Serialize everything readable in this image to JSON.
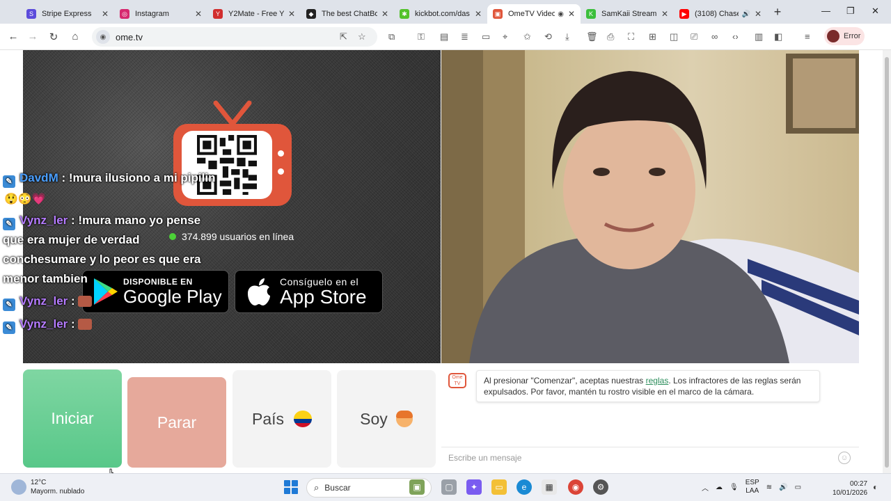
{
  "tabs": [
    {
      "title": "Stripe Express",
      "color": "#5b4bdb",
      "glyph": "S"
    },
    {
      "title": "Instagram",
      "color": "#d6286e",
      "glyph": "◎"
    },
    {
      "title": "Y2Mate - Free Y",
      "color": "#d12e2e",
      "glyph": "Y"
    },
    {
      "title": "The best ChatBo",
      "color": "#222222",
      "glyph": "◆"
    },
    {
      "title": "kickbot.com/das",
      "color": "#53c22b",
      "glyph": "✱"
    },
    {
      "title": "OmeTV Video",
      "color": "#e0563b",
      "glyph": "▣",
      "active": true
    },
    {
      "title": "SamKaii Stream",
      "color": "#3cbf3c",
      "glyph": "K"
    },
    {
      "title": "(3108) Chase",
      "color": "#ff0000",
      "glyph": "▶"
    }
  ],
  "browser": {
    "url": "ome.tv",
    "error_label": "Error"
  },
  "chat_overlay": {
    "lines": [
      {
        "user": "DavdM",
        "text": " : !mura ilusiono a mi pipilin"
      },
      {
        "user": "Vynz_ler",
        "text": " : !mura mano yo pense"
      },
      {
        "text": "que era mujer de verdad"
      },
      {
        "text": "conchesumare y lo peor es que era"
      },
      {
        "text": "menor tambien"
      },
      {
        "user": "Vynz_ler",
        "text": " : "
      },
      {
        "user": "Vynz_ler",
        "text": " : "
      }
    ],
    "emoji_row": "😲😳💗"
  },
  "online": {
    "count_text": "374.899 usuarios en línea"
  },
  "stores": {
    "google_small": "DISPONIBLE EN",
    "google_big": "Google Play",
    "apple_small": "Consíguelo en el",
    "apple_big": "App Store"
  },
  "buttons": {
    "start": "Iniciar",
    "stop": "Parar",
    "country": "País",
    "me": "Soy"
  },
  "notice": {
    "before": "Al presionar \"Comenzar\", aceptas nuestras ",
    "link": "reglas",
    "after": ". Los infractores de las reglas serán expulsados. Por favor, mantén tu rostro visible en el marco de la cámara.",
    "icon_text": "Ome TV"
  },
  "message": {
    "placeholder": "Escribe un mensaje"
  },
  "taskbar": {
    "temp": "12°C",
    "weather": "Mayorm. nublado",
    "search": "Buscar",
    "lang1": "ESP",
    "lang2": "LAA",
    "time": "00:27",
    "date": "10/01/2026"
  },
  "colors": {
    "start": "#58c889",
    "stop": "#e6a99b",
    "brand": "#e0563b"
  }
}
